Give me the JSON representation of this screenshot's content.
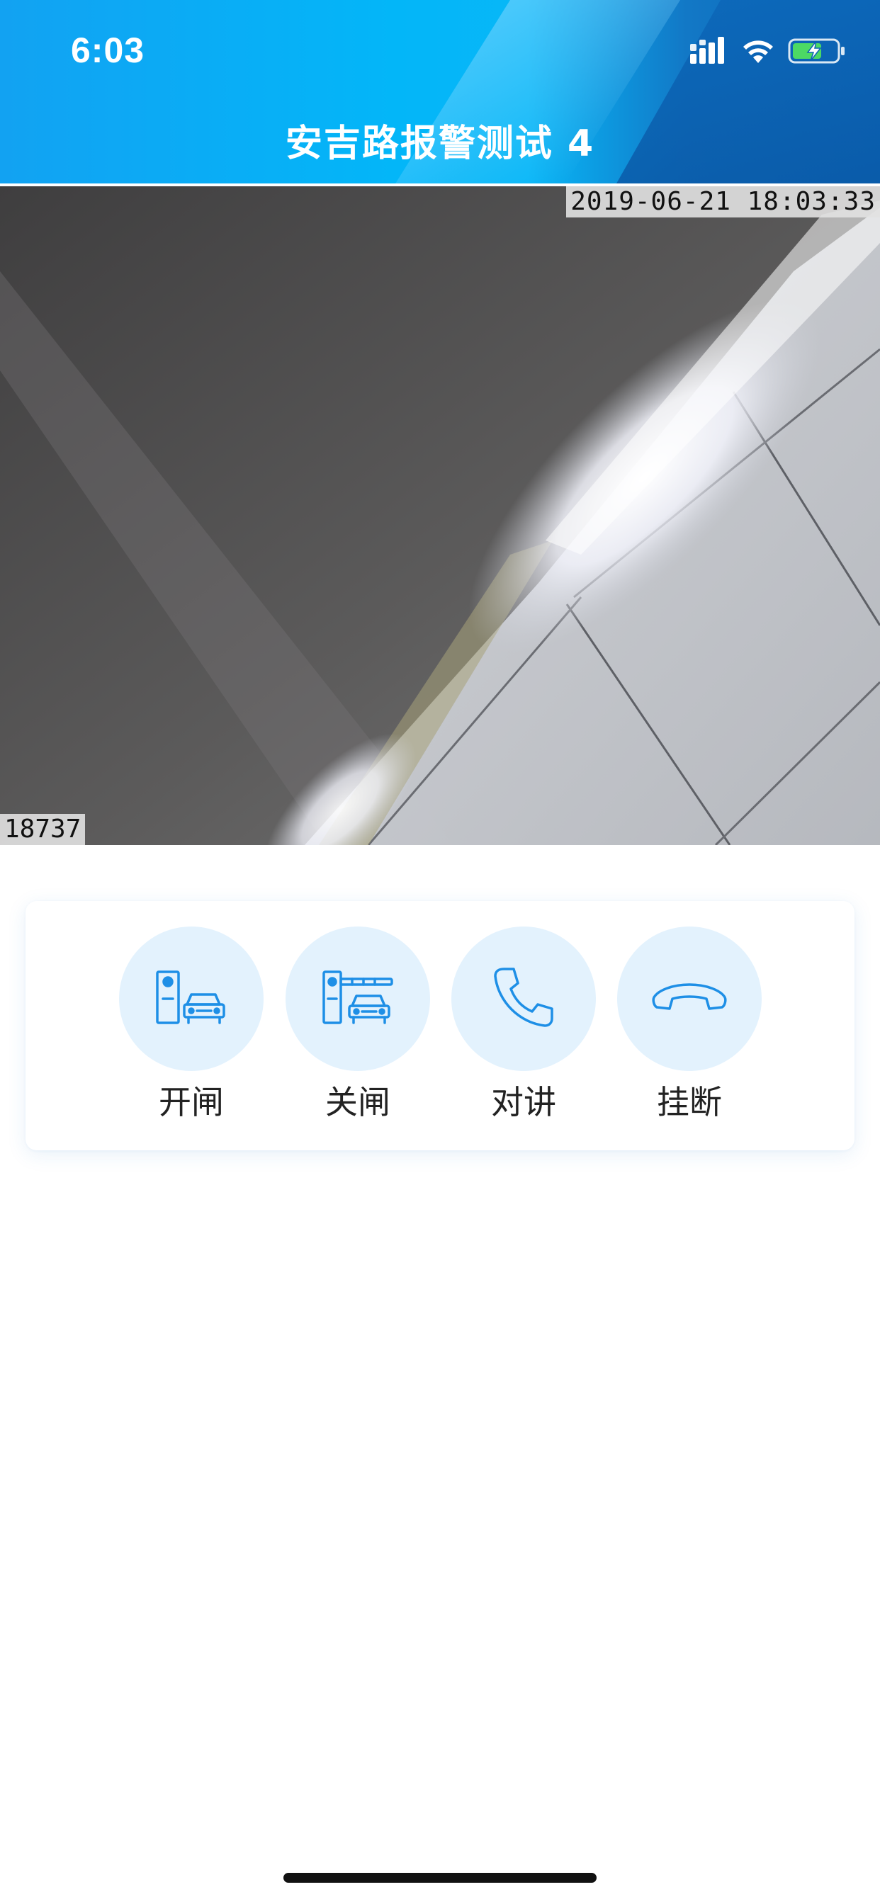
{
  "status_bar": {
    "time": "6:03",
    "icons": [
      "cellular-signal-icon",
      "wifi-icon",
      "battery-charging-icon"
    ],
    "battery_level": 0.6
  },
  "nav": {
    "title": "安吉路报警测试 4"
  },
  "video": {
    "timestamp": "2019-06-21 18:03:33",
    "camera_id": "18737"
  },
  "controls": [
    {
      "label": "开闸",
      "icon": "gate-open-icon"
    },
    {
      "label": "关闸",
      "icon": "gate-close-icon"
    },
    {
      "label": "对讲",
      "icon": "phone-icon"
    },
    {
      "label": "挂断",
      "icon": "hang-up-icon"
    }
  ],
  "colors": {
    "accent": "#1e8fe6",
    "control_bg": "#e3f2fd",
    "header_start": "#12a2f2",
    "header_end": "#0b63b4"
  }
}
